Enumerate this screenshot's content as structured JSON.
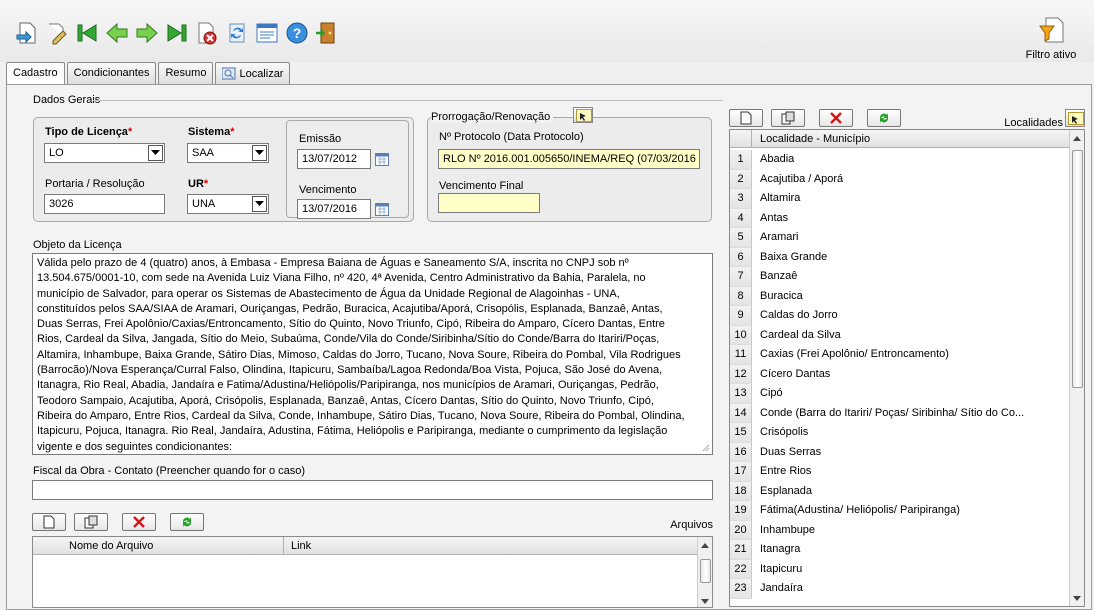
{
  "toolbar": {
    "icons": [
      "import-icon",
      "edit-icon",
      "first-icon",
      "prev-icon",
      "next-icon",
      "last-icon",
      "delete-icon",
      "refresh-icon",
      "list-icon",
      "help-icon",
      "exit-icon"
    ],
    "filter_label": "Filtro ativo"
  },
  "tabs": [
    {
      "label": "Cadastro"
    },
    {
      "label": "Condicionantes"
    },
    {
      "label": "Resumo"
    },
    {
      "label": "Localizar"
    }
  ],
  "dados_gerais": {
    "legend": "Dados Gerais",
    "tipo_licenca_label": "Tipo de Licença",
    "tipo_licenca_value": "LO",
    "sistema_label": "Sistema",
    "sistema_value": "SAA",
    "emissao_label": "Emissão",
    "emissao_value": "13/07/2012",
    "portaria_label": "Portaria / Resolução",
    "portaria_value": "3026",
    "ur_label": "UR",
    "ur_value": "UNA",
    "vencimento_label": "Vencimento",
    "vencimento_value": "13/07/2016",
    "required_mark": "*"
  },
  "prorrogacao": {
    "legend": "Prorrogação/Renovação",
    "protocolo_label": "Nº Protocolo (Data Protocolo)",
    "protocolo_value": "RLO Nº 2016.001.005650/INEMA/REQ (07/03/2016",
    "vencimento_final_label": "Vencimento Final",
    "vencimento_final_value": ""
  },
  "objeto": {
    "label": "Objeto da Licença",
    "lines": [
      "Válida pelo prazo de 4 (quatro) anos, à Embasa - Empresa Baiana de Águas e Saneamento S/A, inscrita no CNPJ sob nº",
      "13.504.675/0001-10, com sede na Avenida Luiz Viana Filho, nº 420, 4ª Avenida, Centro Administrativo da Bahia, Paralela, no",
      "município de Salvador, para operar os Sistemas de Abastecimento de Água da Unidade Regional de Alagoinhas - UNA,",
      "constituídos  pelos SAA/SIAA de Aramari, Ouriçangas, Pedrão, Buracica, Acajutiba/Aporá, Crisopólis, Esplanada, Banzaê, Antas,",
      "Duas Serras, Frei Apolônio/Caxias/Entroncamento, Sítio do Quinto, Novo Triunfo, Cipó, Ribeira do Amparo, Cícero Dantas, Entre",
      "Rios, Cardeal da Silva, Jangada, Sítio do Meio, Subaúma, Conde/Vila do Conde/Siribinha/Sítio do Conde/Barra do Itariri/Poças,",
      "Altamira, Inhambupe, Baixa Grande, Sátiro Dias, Mimoso, Caldas do Jorro, Tucano, Nova Soure, Ribeira do Pombal, Vila Rodrigues",
      "(Barrocão)/Nova Esperança/Curral Falso, Olindina, Itapicuru, Sambaíba/Lagoa Redonda/Boa Vista, Pojuca, São José do Avena,",
      "Itanagra, Rio Real, Abadia, Jandaíra e Fatima/Adustina/Heliópolis/Paripiranga, nos municípios de Aramari, Ouriçangas, Pedrão,",
      "Teodoro Sampaio, Acajutiba, Aporá, Crisópolis, Esplanada, Banzaê, Antas, Cícero Dantas, Sítio do Quinto, Novo Triunfo, Cipó,",
      "Ribeira do Amparo, Entre Rios, Cardeal da Silva, Conde, Inhambupe, Sátiro Dias, Tucano, Nova Soure, Ribeira do Pombal, Olindina,",
      "Itapicuru, Pojuca, Itanagra. Rio Real, Jandaíra, Adustina, Fátima, Heliópolis e Paripiranga, mediante o cumprimento da legislação",
      "vigente e dos seguintes condicionantes:"
    ]
  },
  "fiscal": {
    "label": "Fiscal da Obra - Contato (Preencher quando for o caso)",
    "value": ""
  },
  "arquivos": {
    "title": "Arquivos",
    "columns": [
      "Nome do Arquivo",
      "Link"
    ]
  },
  "localidades": {
    "title": "Localidades",
    "column": "Localidade - Município",
    "rows": [
      {
        "n": "1",
        "name": "Abadia"
      },
      {
        "n": "2",
        "name": "Acajutiba / Aporá"
      },
      {
        "n": "3",
        "name": "Altamira"
      },
      {
        "n": "4",
        "name": "Antas"
      },
      {
        "n": "5",
        "name": "Aramari"
      },
      {
        "n": "6",
        "name": "Baixa Grande"
      },
      {
        "n": "7",
        "name": "Banzaê"
      },
      {
        "n": "8",
        "name": "Buracica"
      },
      {
        "n": "9",
        "name": "Caldas do Jorro"
      },
      {
        "n": "10",
        "name": "Cardeal da Silva"
      },
      {
        "n": "11",
        "name": "Caxias (Frei Apolônio/ Entroncamento)"
      },
      {
        "n": "12",
        "name": "Cícero Dantas"
      },
      {
        "n": "13",
        "name": "Cipó"
      },
      {
        "n": "14",
        "name": "Conde (Barra do Itariri/ Poças/ Siribinha/ Sítio do Co..."
      },
      {
        "n": "15",
        "name": "Crisópolis"
      },
      {
        "n": "16",
        "name": "Duas Serras"
      },
      {
        "n": "17",
        "name": "Entre Rios"
      },
      {
        "n": "18",
        "name": "Esplanada"
      },
      {
        "n": "19",
        "name": "Fátima(Adustina/ Heliópolis/ Paripiranga)"
      },
      {
        "n": "20",
        "name": "Inhambupe"
      },
      {
        "n": "21",
        "name": "Itanagra"
      },
      {
        "n": "22",
        "name": "Itapicuru"
      },
      {
        "n": "23",
        "name": "Jandaíra"
      }
    ]
  }
}
